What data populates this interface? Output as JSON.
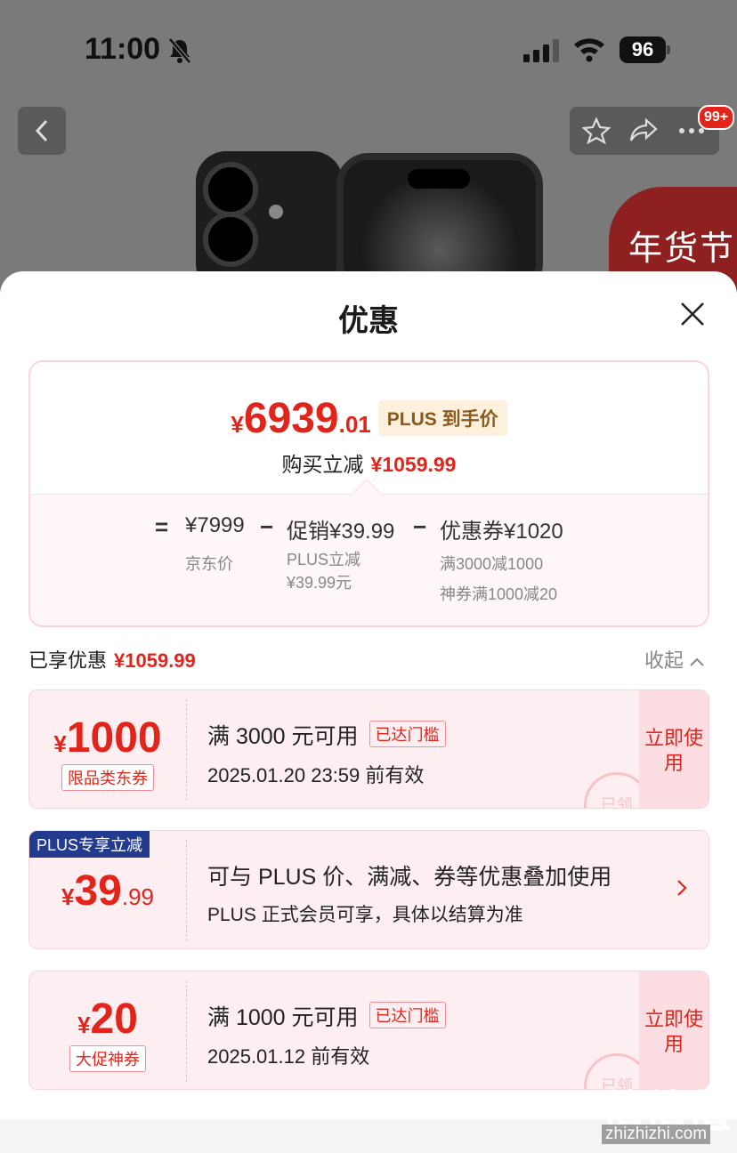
{
  "status_bar": {
    "time": "11:00",
    "battery": "96"
  },
  "header": {
    "cart_badge": "99+",
    "banner_text": "年货节"
  },
  "sheet": {
    "title": "优惠",
    "summary": {
      "price_yen": "¥",
      "price_main": "6939",
      "price_decimal": ".01",
      "price_tag": "PLUS 到手价",
      "reduce_label": "购买立减",
      "reduce_value": "¥1059.99",
      "formula": {
        "equals": "=",
        "base": "¥7999",
        "base_label": "京东价",
        "minus1": "−",
        "promo": "促销¥39.99",
        "promo_sub1": "PLUS立减",
        "promo_sub2": "¥39.99元",
        "minus2": "−",
        "coupon": "优惠券¥1020",
        "coupon_sub1": "满3000减1000",
        "coupon_sub2": "神券满1000减20"
      }
    },
    "enjoyed_label": "已享优惠",
    "enjoyed_value": "¥1059.99",
    "collapse_label": "收起",
    "coupons": [
      {
        "yen": "¥",
        "amount": "1000",
        "decimal": "",
        "label": "限品类东券",
        "condition": "满 3000 元可用",
        "threshold": "已达门槛",
        "validity": "2025.01.20 23:59 前有效",
        "use": "立即使用",
        "stamp": "已领"
      },
      {
        "ribbon": "PLUS专享立减",
        "yen": "¥",
        "amount": "39",
        "decimal": ".99",
        "line1": "可与 PLUS 价、满减、券等优惠叠加使用",
        "line2": "PLUS 正式会员可享，具体以结算为准"
      },
      {
        "yen": "¥",
        "amount": "20",
        "decimal": "",
        "label": "大促神券",
        "condition": "满 1000 元可用",
        "threshold": "已达门槛",
        "validity": "2025.01.12 前有效",
        "use": "立即使用",
        "stamp": "已领"
      }
    ]
  },
  "watermark": {
    "logo": "值值值",
    "site": "zhizhizhi.com"
  },
  "colors": {
    "accent": "#e1251b",
    "plus_blue": "#233b8f",
    "coupon_bg": "#fdeff1"
  }
}
